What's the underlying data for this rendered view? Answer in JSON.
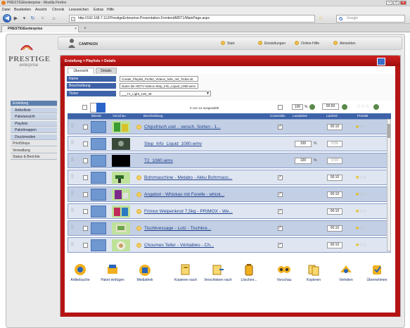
{
  "browser": {
    "window_title": "PRESTIGEenterprise - Mozilla Firefox",
    "menu": [
      "Datei",
      "Bearbeiten",
      "Ansicht",
      "Chronik",
      "Lesezeichen",
      "Extras",
      "Hilfe"
    ],
    "url": "http://192.168.7.112/PrestigeEnterprise.Presentation.FrontendMDT1/MainPage.aspx",
    "search_placeholder": "Google",
    "tab_label": "PRESTIGEenterprise",
    "new_tab": "+"
  },
  "app": {
    "logo_text": "PRESTIGE",
    "logo_sub": "enterprise",
    "username": "CAMPAIGN",
    "topnav": [
      "Start",
      "Einstellungen",
      "Online-Hilfe",
      "Abmelden"
    ],
    "breadcrumb": "Erstellung  >  Playlists  >  Details"
  },
  "sidebar": [
    {
      "label": "Erstellung",
      "kind": "head"
    },
    {
      "label": "Artikelliste",
      "kind": "sub"
    },
    {
      "label": "Paketansicht",
      "kind": "sub"
    },
    {
      "label": "Playlists",
      "kind": "sub"
    },
    {
      "label": "Paketmappen",
      "kind": "sub"
    },
    {
      "label": "Druckmedien",
      "kind": "sub"
    },
    {
      "label": "PrintShops",
      "kind": "plain"
    },
    {
      "label": "Verwaltung",
      "kind": "plain"
    },
    {
      "label": "Status & Berichte",
      "kind": "plain"
    }
  ],
  "subtabs": [
    "Übersicht",
    "Details"
  ],
  "form": {
    "name_label": "Name",
    "name_value": "Create_Playlist_PL062_Videos_hdtv_mit_Ticker.xlt",
    "desc_label": "Beschreibung",
    "desc_value": "lauter die HDTV-Videos Step_Info_Liquid_1080.wmv",
    "ticker_label": "Ticker",
    "ticker_value": "___T1_Light_128_49"
  },
  "controls": {
    "selected_text": "0 von 12 ausgewählt",
    "volume": "100",
    "volume_unit": "%",
    "time": "00:00"
  },
  "columns": [
    "Blende",
    "Vorschau",
    "Beschreibung",
    "Contentklo",
    "Lautstärke",
    "Laufzeit",
    "Priorität"
  ],
  "rows": [
    {
      "desc": "Chipsfrisch und .. versch. Sorten - 1...",
      "thumb": "chips",
      "checked": true,
      "volume": "",
      "time": "00:10",
      "stars": 1
    },
    {
      "desc": "Step_Info_Liquid_1080.wmv",
      "thumb": "video",
      "checked": false,
      "volume": "100",
      "time": "0:56",
      "stars": 0
    },
    {
      "desc": "T2_1080.wmv",
      "thumb": "black",
      "checked": false,
      "volume": "100",
      "time": "0:59",
      "stars": 0
    },
    {
      "desc": "Bohrmaschine - Metabo - Akku Bohrmasc...",
      "thumb": "drill",
      "checked": true,
      "volume": "",
      "time": "00:10",
      "stars": 1
    },
    {
      "desc": "Angebot - Whiskas mit Forelle - whisk...",
      "thumb": "whiskas",
      "checked": true,
      "volume": "",
      "time": "00:10",
      "stars": 1
    },
    {
      "desc": "Frimox Welpenknot 7,5kg - PRIMOX - We...",
      "thumb": "pet",
      "checked": true,
      "volume": "",
      "time": "00:10",
      "stars": 1
    },
    {
      "desc": "Tischkressage - Lutz - Tischkre...",
      "thumb": "cress",
      "checked": true,
      "volume": "",
      "time": "00:10",
      "stars": 1
    },
    {
      "desc": "Choumes Teller - Véritables - Ch...",
      "thumb": "plate",
      "checked": true,
      "volume": "",
      "time": "00:10",
      "stars": 1
    }
  ],
  "toolbar": [
    "Artikelsuche",
    "Paket einfügen",
    "Mediathek",
    "Kopieren nach",
    "Verschieben nach",
    "Löschen...",
    "Vorschau",
    "Kopieren",
    "Verteilen",
    "Übernehmen"
  ],
  "colors": {
    "accent_red": "#b41414",
    "nav_blue": "#3d62a8",
    "row_odd": "#c3cfe5",
    "row_even": "#dfe6f2"
  }
}
